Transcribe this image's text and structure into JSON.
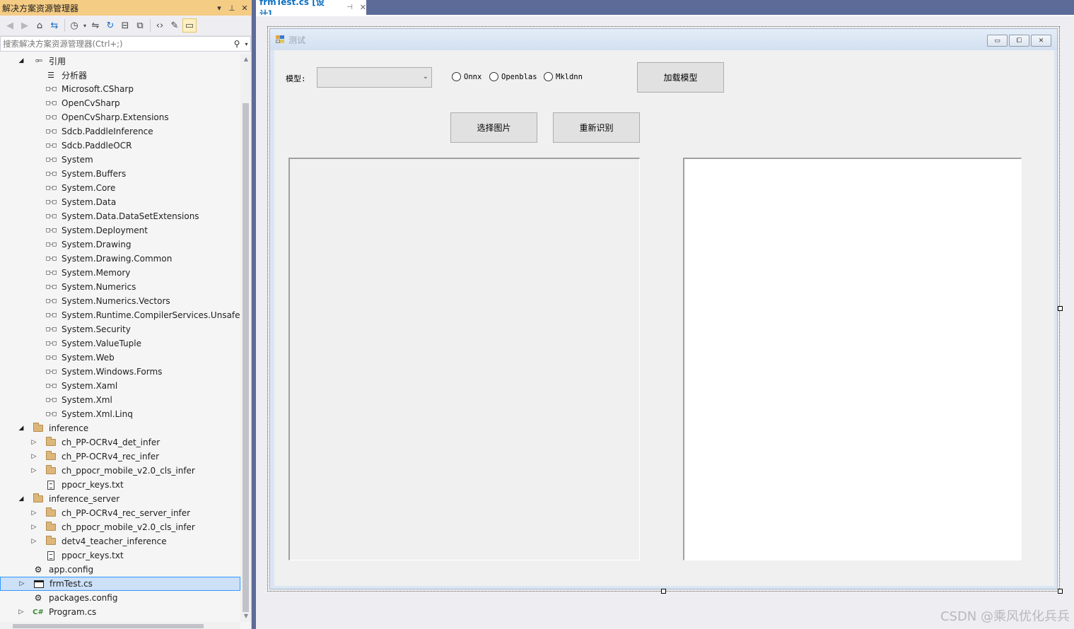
{
  "solution_explorer": {
    "title": "解决方案资源管理器",
    "title_buttons": [
      "▾",
      "⊥",
      "✕"
    ],
    "search_placeholder": "搜索解决方案资源管理器(Ctrl+;)",
    "tree": [
      {
        "label": "引用",
        "type": "refs-folder",
        "depth": 1,
        "expander": "expanded"
      },
      {
        "label": "分析器",
        "type": "analyzer",
        "depth": 2,
        "expander": "none"
      },
      {
        "label": "Microsoft.CSharp",
        "type": "reference",
        "depth": 2,
        "expander": "none"
      },
      {
        "label": "OpenCvSharp",
        "type": "reference",
        "depth": 2,
        "expander": "none"
      },
      {
        "label": "OpenCvSharp.Extensions",
        "type": "reference",
        "depth": 2,
        "expander": "none"
      },
      {
        "label": "Sdcb.PaddleInference",
        "type": "reference",
        "depth": 2,
        "expander": "none"
      },
      {
        "label": "Sdcb.PaddleOCR",
        "type": "reference",
        "depth": 2,
        "expander": "none"
      },
      {
        "label": "System",
        "type": "reference",
        "depth": 2,
        "expander": "none"
      },
      {
        "label": "System.Buffers",
        "type": "reference",
        "depth": 2,
        "expander": "none"
      },
      {
        "label": "System.Core",
        "type": "reference",
        "depth": 2,
        "expander": "none"
      },
      {
        "label": "System.Data",
        "type": "reference",
        "depth": 2,
        "expander": "none"
      },
      {
        "label": "System.Data.DataSetExtensions",
        "type": "reference",
        "depth": 2,
        "expander": "none"
      },
      {
        "label": "System.Deployment",
        "type": "reference",
        "depth": 2,
        "expander": "none"
      },
      {
        "label": "System.Drawing",
        "type": "reference",
        "depth": 2,
        "expander": "none"
      },
      {
        "label": "System.Drawing.Common",
        "type": "reference",
        "depth": 2,
        "expander": "none"
      },
      {
        "label": "System.Memory",
        "type": "reference",
        "depth": 2,
        "expander": "none"
      },
      {
        "label": "System.Numerics",
        "type": "reference",
        "depth": 2,
        "expander": "none"
      },
      {
        "label": "System.Numerics.Vectors",
        "type": "reference",
        "depth": 2,
        "expander": "none"
      },
      {
        "label": "System.Runtime.CompilerServices.Unsafe",
        "type": "reference",
        "depth": 2,
        "expander": "none"
      },
      {
        "label": "System.Security",
        "type": "reference",
        "depth": 2,
        "expander": "none"
      },
      {
        "label": "System.ValueTuple",
        "type": "reference",
        "depth": 2,
        "expander": "none"
      },
      {
        "label": "System.Web",
        "type": "reference",
        "depth": 2,
        "expander": "none"
      },
      {
        "label": "System.Windows.Forms",
        "type": "reference",
        "depth": 2,
        "expander": "none"
      },
      {
        "label": "System.Xaml",
        "type": "reference",
        "depth": 2,
        "expander": "none"
      },
      {
        "label": "System.Xml",
        "type": "reference",
        "depth": 2,
        "expander": "none"
      },
      {
        "label": "System.Xml.Linq",
        "type": "reference",
        "depth": 2,
        "expander": "none"
      },
      {
        "label": "inference",
        "type": "folder",
        "depth": 1,
        "expander": "expanded"
      },
      {
        "label": "ch_PP-OCRv4_det_infer",
        "type": "folder",
        "depth": 2,
        "expander": "collapsed"
      },
      {
        "label": "ch_PP-OCRv4_rec_infer",
        "type": "folder",
        "depth": 2,
        "expander": "collapsed"
      },
      {
        "label": "ch_ppocr_mobile_v2.0_cls_infer",
        "type": "folder",
        "depth": 2,
        "expander": "collapsed"
      },
      {
        "label": "ppocr_keys.txt",
        "type": "file",
        "depth": 2,
        "expander": "none"
      },
      {
        "label": "inference_server",
        "type": "folder",
        "depth": 1,
        "expander": "expanded"
      },
      {
        "label": "ch_PP-OCRv4_rec_server_infer",
        "type": "folder",
        "depth": 2,
        "expander": "collapsed"
      },
      {
        "label": "ch_ppocr_mobile_v2.0_cls_infer",
        "type": "folder",
        "depth": 2,
        "expander": "collapsed"
      },
      {
        "label": "detv4_teacher_inference",
        "type": "folder",
        "depth": 2,
        "expander": "collapsed"
      },
      {
        "label": "ppocr_keys.txt",
        "type": "file",
        "depth": 2,
        "expander": "none"
      },
      {
        "label": "app.config",
        "type": "config",
        "depth": 1,
        "expander": "none"
      },
      {
        "label": "frmTest.cs",
        "type": "form",
        "depth": 1,
        "expander": "collapsed",
        "selected": true
      },
      {
        "label": "packages.config",
        "type": "config",
        "depth": 1,
        "expander": "none"
      },
      {
        "label": "Program.cs",
        "type": "csharp",
        "depth": 1,
        "expander": "collapsed"
      }
    ]
  },
  "editor": {
    "tab_label": "frmTest.cs [设计]",
    "tab_pin": "⊣",
    "tab_close": "✕"
  },
  "form": {
    "title": "测试",
    "model_label": "模型:",
    "model_value": "",
    "radios": [
      "Onnx",
      "Openblas",
      "Mkldnn"
    ],
    "load_button": "加载模型",
    "select_button": "选择图片",
    "rerecognize_button": "重新识别"
  },
  "watermark": "CSDN @乘风优化兵兵"
}
